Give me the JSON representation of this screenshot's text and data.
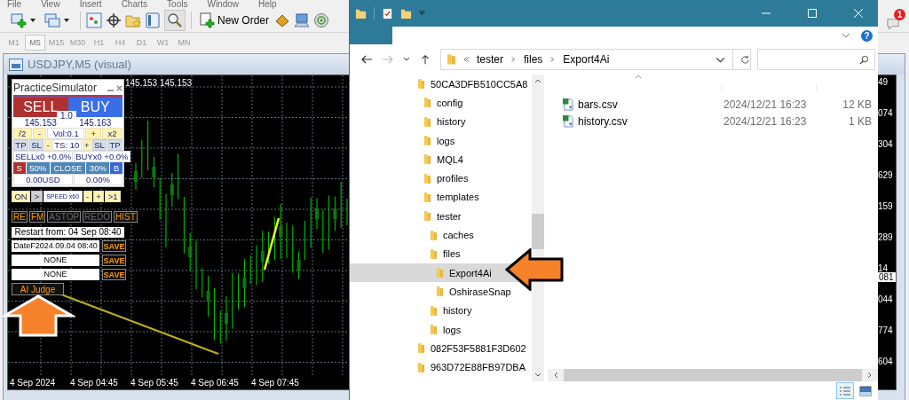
{
  "terminal": {
    "menu": [
      "File",
      "View",
      "Insert",
      "Charts",
      "Tools",
      "Window",
      "Help"
    ],
    "toolbar": {
      "new_order": "New Order",
      "notification_count": "1"
    },
    "timeframes": [
      {
        "label": "M1",
        "selected": false
      },
      {
        "label": "M5",
        "selected": true
      },
      {
        "label": "M15",
        "selected": false
      },
      {
        "label": "M30",
        "selected": false
      },
      {
        "label": "H1",
        "selected": false
      },
      {
        "label": "H4",
        "selected": false
      },
      {
        "label": "D1",
        "selected": false
      },
      {
        "label": "W1",
        "selected": false
      },
      {
        "label": "MN",
        "selected": false
      }
    ],
    "chart": {
      "title": "USDJPY,M5 (visual)",
      "price_header": "145.153 145.153",
      "time_labels": [
        "4 Sep 2024",
        "4 Sep 04:45",
        "4 Sep 05:45",
        "4 Sep 06:45",
        "4 Sep 07:45"
      ],
      "price_labels": [
        "49",
        "074",
        "304",
        "629",
        "159",
        "289",
        "14",
        "044",
        "774",
        "604"
      ],
      "current_price": "081"
    }
  },
  "simulator": {
    "title": "PracticeSimulator",
    "sell": "SELL",
    "buy": "BUY",
    "lot": "1.0",
    "bid": "145.153",
    "ask": "145.163",
    "volume_bar": [
      {
        "text": "/2",
        "kind": "adjust"
      },
      {
        "text": "-",
        "kind": "adjust"
      },
      {
        "text": "Vol:0.1",
        "kind": "value"
      },
      {
        "text": "+",
        "kind": "adjust"
      },
      {
        "text": "x2",
        "kind": "adjust"
      }
    ],
    "stops_bar": [
      {
        "text": "TP",
        "kind": "target"
      },
      {
        "text": "SL",
        "kind": "target"
      },
      {
        "text": "-",
        "kind": "adjust"
      },
      {
        "text": "TS: 10",
        "kind": "value"
      },
      {
        "text": "+",
        "kind": "adjust"
      },
      {
        "text": "SL",
        "kind": "target"
      },
      {
        "text": "TP",
        "kind": "target"
      }
    ],
    "positions_bar": [
      {
        "text": "SELLx0 +0.0%",
        "kind": "value"
      },
      {
        "text": "BUYx0 +0.0%",
        "kind": "value"
      }
    ],
    "close_bar": [
      {
        "text": "S",
        "kind": "sell"
      },
      {
        "text": "50%",
        "kind": "close"
      },
      {
        "text": "CLOSE",
        "kind": "close"
      },
      {
        "text": "30%",
        "kind": "close"
      },
      {
        "text": "B",
        "kind": "buy"
      }
    ],
    "totals_bar": [
      {
        "text": "0.00USD",
        "kind": "value"
      },
      {
        "text": "0.00%",
        "kind": "value"
      }
    ],
    "controls": [
      {
        "text": "ON",
        "kind": "toggle"
      },
      {
        "text": ">",
        "kind": "play"
      },
      {
        "text": "SPEED x60",
        "kind": "speed"
      },
      {
        "text": "-",
        "kind": "adjust"
      },
      {
        "text": "+",
        "kind": "adjust"
      },
      {
        "text": ">1",
        "kind": "adjust"
      }
    ],
    "modes": [
      {
        "text": "RE",
        "active": true
      },
      {
        "text": "FM",
        "active": true
      },
      {
        "text": "ASTOP",
        "active": false
      },
      {
        "text": "REDO",
        "active": false
      },
      {
        "text": "HIST",
        "active": true
      }
    ],
    "restart": "Restart from: 04 Sep 08:40",
    "save_slots": [
      {
        "label": "DateF2024.09.04 08:40",
        "button": "SAVE"
      },
      {
        "label": "NONE",
        "button": "SAVE"
      },
      {
        "label": "NONE",
        "button": "SAVE"
      }
    ],
    "ai_judge": "AI Judge"
  },
  "explorer": {
    "help": "?",
    "address": [
      "tester",
      "files",
      "Export4Ai"
    ],
    "tree": [
      {
        "label": "50CA3DFB510CC5A8",
        "selected": false,
        "children": [
          {
            "label": "config",
            "selected": false
          },
          {
            "label": "history",
            "selected": false
          },
          {
            "label": "logs",
            "selected": false
          },
          {
            "label": "MQL4",
            "selected": false
          },
          {
            "label": "profiles",
            "selected": false
          },
          {
            "label": "templates",
            "selected": false
          },
          {
            "label": "tester",
            "selected": false,
            "children": [
              {
                "label": "caches",
                "selected": false
              },
              {
                "label": "files",
                "selected": false,
                "children": [
                  {
                    "label": "Export4Ai",
                    "selected": true
                  },
                  {
                    "label": "OshiraseSnap",
                    "selected": false
                  }
                ]
              },
              {
                "label": "history",
                "selected": false
              },
              {
                "label": "logs",
                "selected": false
              }
            ]
          }
        ]
      },
      {
        "label": "082F53F5881F3D602",
        "selected": false
      },
      {
        "label": "963D72E88FB97DBA",
        "selected": false
      }
    ],
    "files": [
      {
        "name": "bars.csv",
        "modified": "2024/12/21 16:23",
        "size": "12 KB"
      },
      {
        "name": "history.csv",
        "modified": "2024/12/21 16:23",
        "size": "1 KB"
      }
    ]
  }
}
